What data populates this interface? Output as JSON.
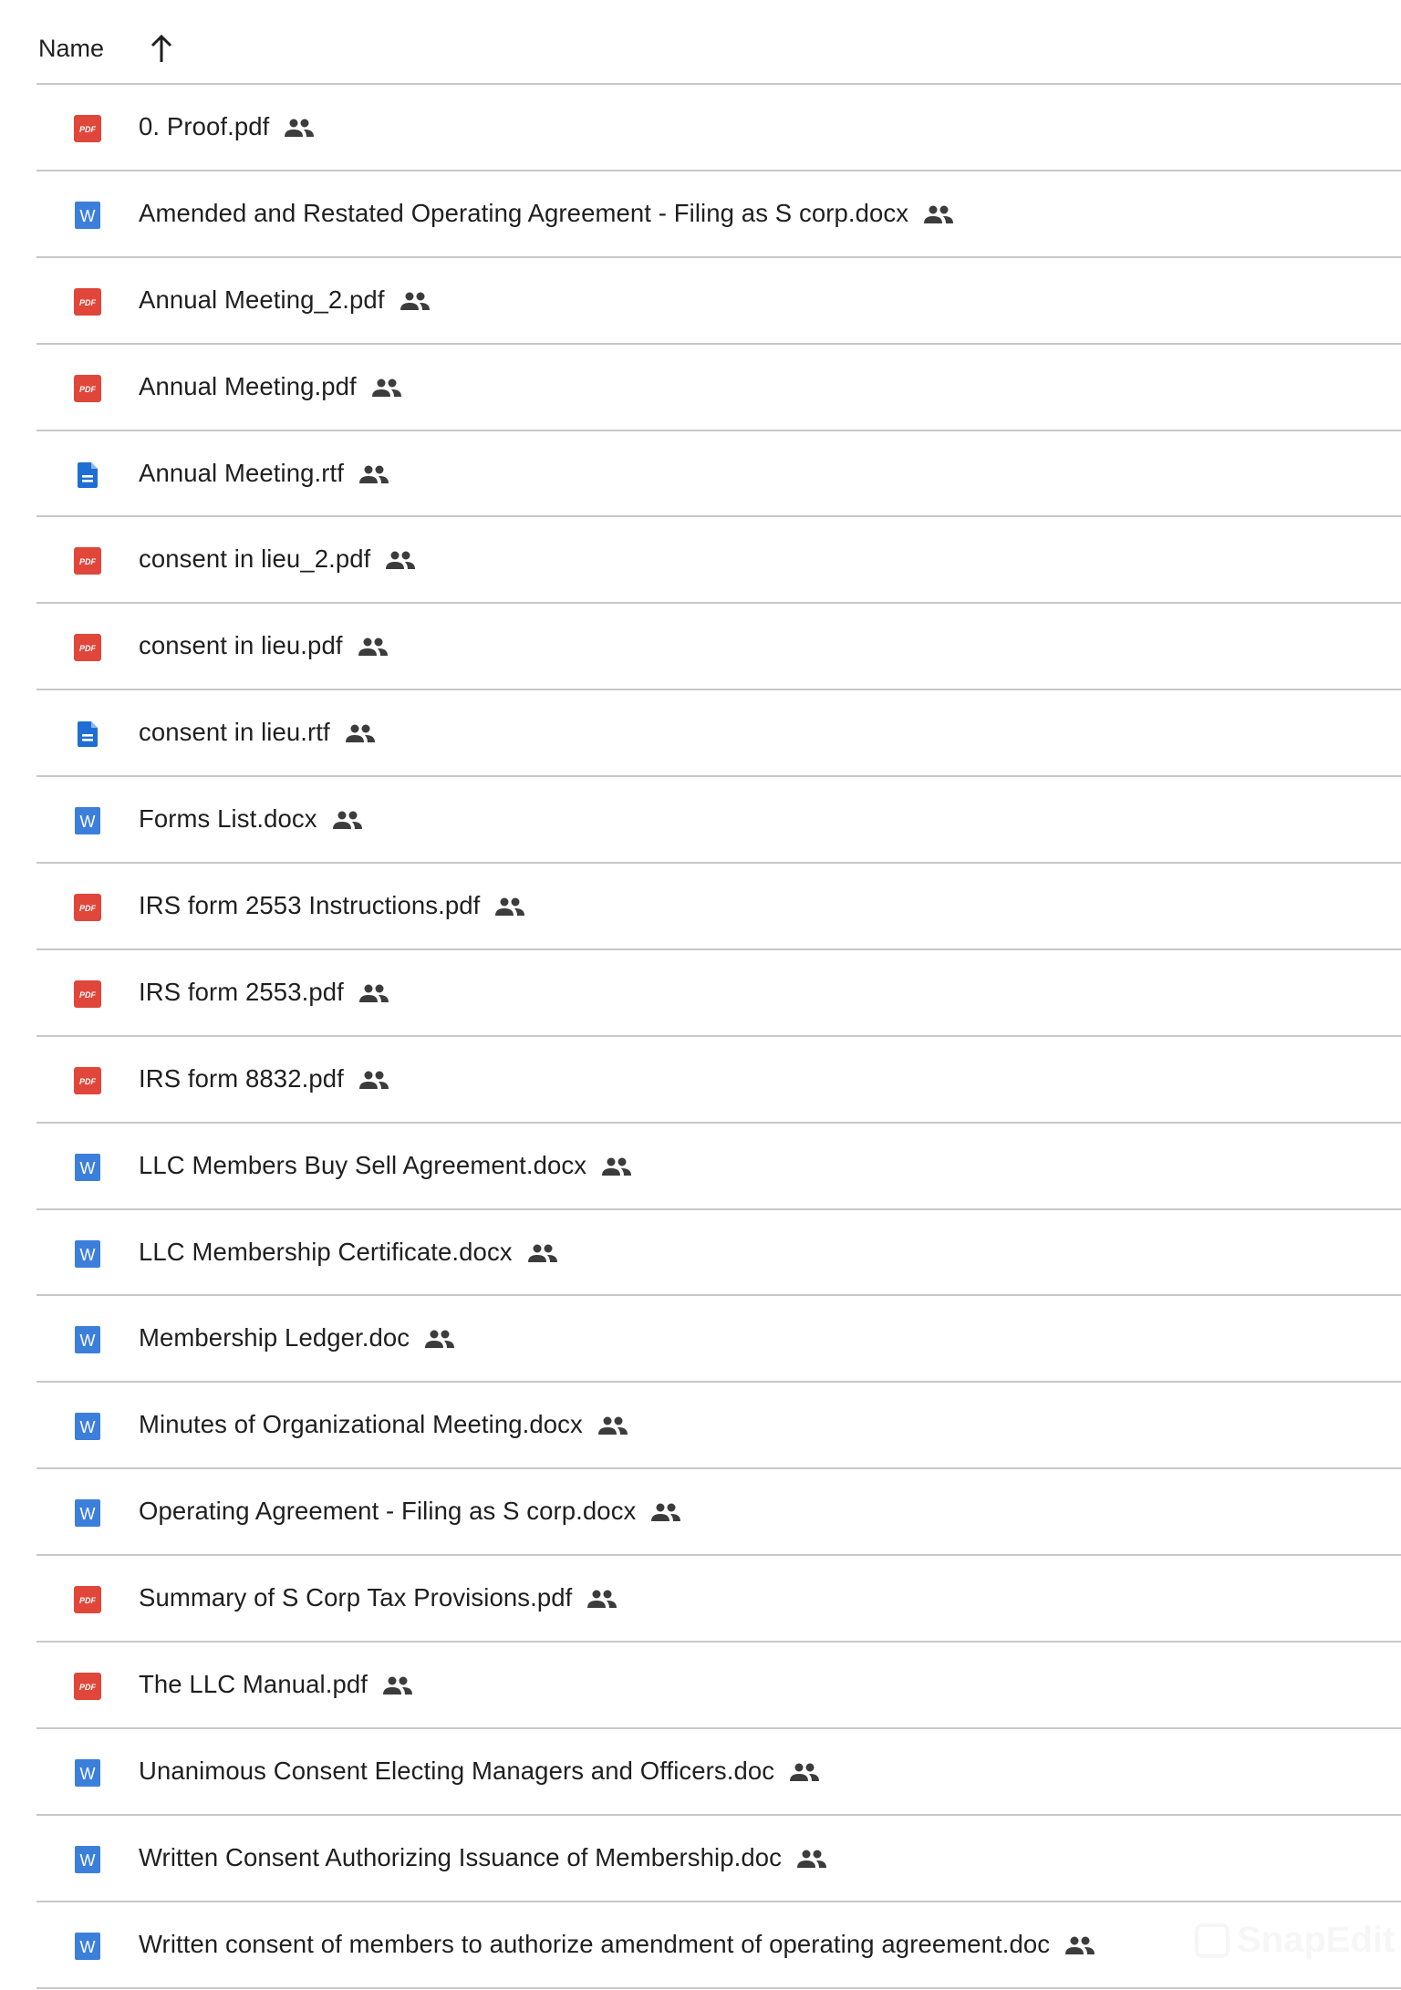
{
  "header": {
    "column_label": "Name",
    "sort_icon": "arrow-up-icon"
  },
  "colors": {
    "pdf": "#e0463a",
    "word": "#3c7fdb",
    "doc": "#1f6ed4",
    "divider": "#c8c8c8",
    "text": "#1f1f1f"
  },
  "files": [
    {
      "name": "0. Proof.pdf",
      "type": "pdf",
      "shared": true
    },
    {
      "name": "Amended and Restated Operating Agreement - Filing as S corp.docx",
      "type": "word",
      "shared": true
    },
    {
      "name": "Annual Meeting_2.pdf",
      "type": "pdf",
      "shared": true
    },
    {
      "name": "Annual Meeting.pdf",
      "type": "pdf",
      "shared": true
    },
    {
      "name": "Annual Meeting.rtf",
      "type": "doc",
      "shared": true
    },
    {
      "name": "consent in lieu_2.pdf",
      "type": "pdf",
      "shared": true
    },
    {
      "name": "consent in lieu.pdf",
      "type": "pdf",
      "shared": true
    },
    {
      "name": "consent in lieu.rtf",
      "type": "doc",
      "shared": true
    },
    {
      "name": "Forms List.docx",
      "type": "word",
      "shared": true
    },
    {
      "name": "IRS form 2553 Instructions.pdf",
      "type": "pdf",
      "shared": true
    },
    {
      "name": "IRS form 2553.pdf",
      "type": "pdf",
      "shared": true
    },
    {
      "name": "IRS form 8832.pdf",
      "type": "pdf",
      "shared": true
    },
    {
      "name": "LLC Members Buy Sell Agreement.docx",
      "type": "word",
      "shared": true
    },
    {
      "name": "LLC Membership Certificate.docx",
      "type": "word",
      "shared": true
    },
    {
      "name": "Membership Ledger.doc",
      "type": "word",
      "shared": true
    },
    {
      "name": "Minutes of Organizational Meeting.docx",
      "type": "word",
      "shared": true
    },
    {
      "name": "Operating Agreement - Filing as S corp.docx",
      "type": "word",
      "shared": true
    },
    {
      "name": "Summary of S Corp Tax Provisions.pdf",
      "type": "pdf",
      "shared": true
    },
    {
      "name": "The LLC Manual.pdf",
      "type": "pdf",
      "shared": true
    },
    {
      "name": "Unanimous Consent Electing Managers and Officers.doc",
      "type": "word",
      "shared": true
    },
    {
      "name": "Written Consent Authorizing Issuance of Membership.doc",
      "type": "word",
      "shared": true
    },
    {
      "name": "Written consent of members to authorize amendment of operating agreement.doc",
      "type": "word",
      "shared": true
    }
  ],
  "watermark": "SnapEdit"
}
